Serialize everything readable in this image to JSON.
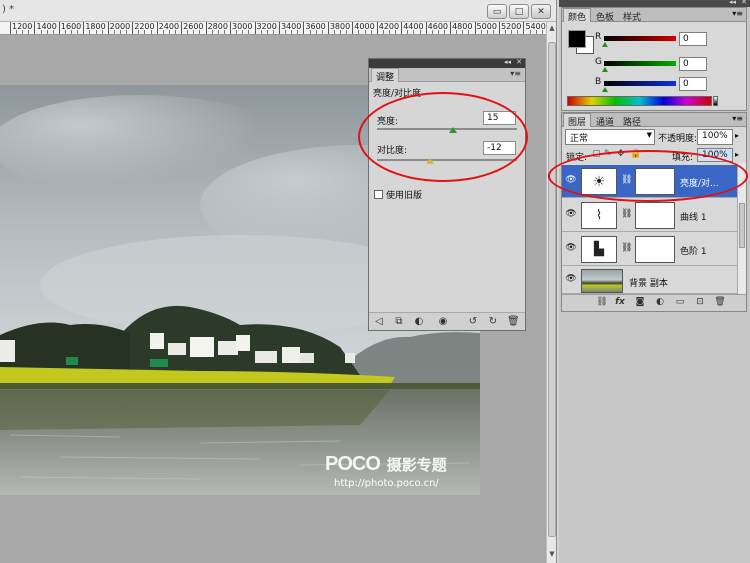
{
  "document": {
    "title_fragment": ") *",
    "minimize_glyph": "▭",
    "restore_glyph": "□",
    "close_glyph": "✕"
  },
  "ruler": {
    "labels": [
      "1200",
      "1400",
      "1600",
      "1800",
      "2000",
      "2200",
      "2400",
      "2600",
      "2800",
      "3000",
      "3200",
      "3400",
      "3600",
      "3800",
      "4000",
      "4200",
      "4400",
      "4600",
      "4800",
      "5000",
      "5200",
      "5400"
    ]
  },
  "adjustments": {
    "tab_label": "调整",
    "panel_title": "亮度/对比度",
    "brightness_label": "亮度:",
    "brightness_value": "15",
    "contrast_label": "对比度:",
    "contrast_value": "-12",
    "legacy_label": "使用旧版"
  },
  "color_panel": {
    "tabs": [
      "颜色",
      "色板",
      "样式"
    ],
    "r_label": "R",
    "g_label": "G",
    "b_label": "B",
    "r_value": "0",
    "g_value": "0",
    "b_value": "0"
  },
  "layers_panel": {
    "tabs": [
      "图层",
      "通道",
      "路径"
    ],
    "blend_mode": "正常",
    "opacity_label": "不透明度:",
    "opacity_value": "100%",
    "lock_label": "锁定:",
    "fill_label": "填充:",
    "fill_value": "100%",
    "layers": [
      {
        "name": "亮度/对...",
        "active": true
      },
      {
        "name": "曲线 1",
        "active": false
      },
      {
        "name": "色阶 1",
        "active": false
      },
      {
        "name": "背景 副本",
        "active": false
      }
    ]
  },
  "watermark": {
    "brand": "POCO",
    "tagline": "摄影专题",
    "url": "http://photo.poco.cn/"
  },
  "colors": {
    "active_layer": "#3a66c6",
    "annotation": "#e01212",
    "slider_thumb": "#1e8f1e"
  }
}
